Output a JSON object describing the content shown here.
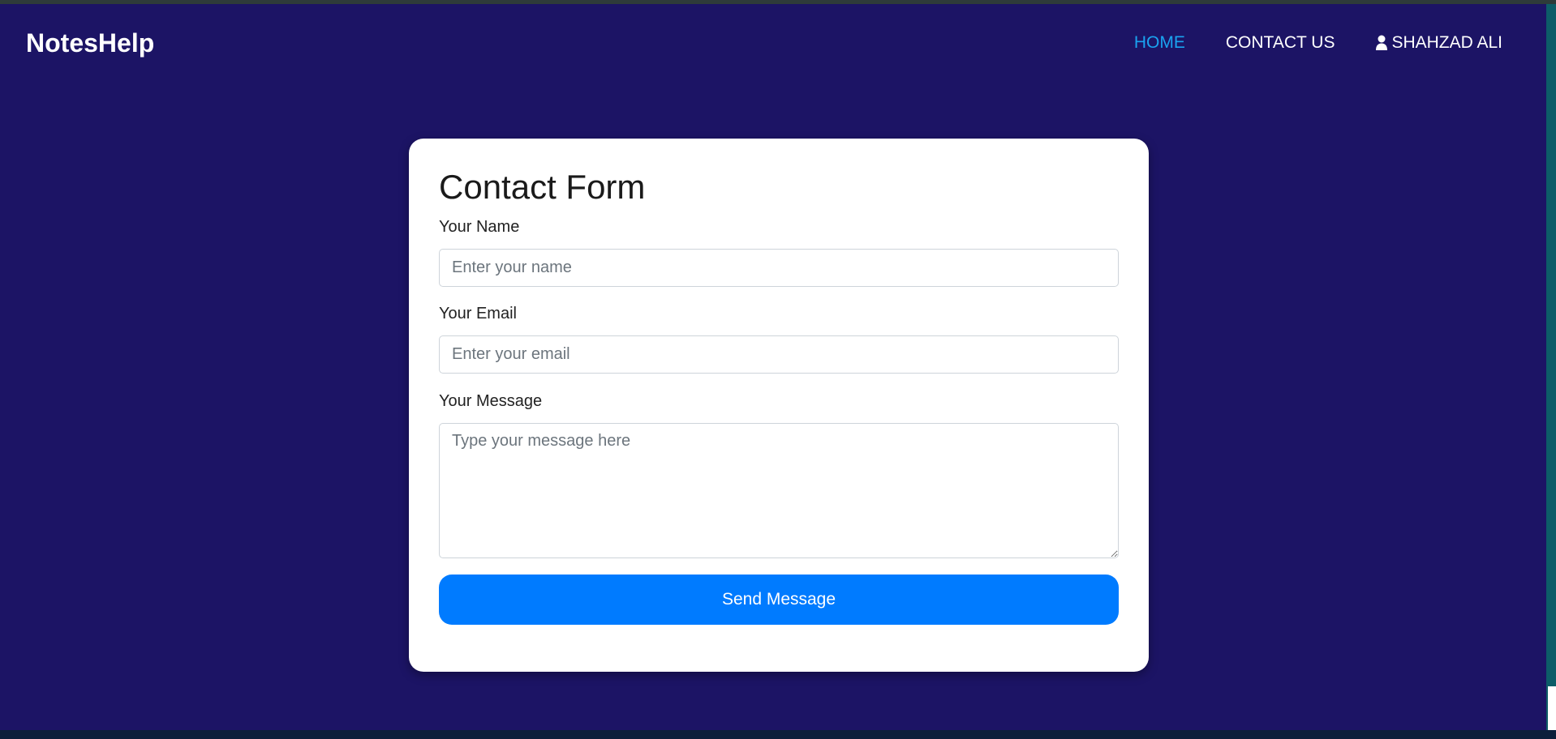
{
  "navbar": {
    "brand": "NotesHelp",
    "links": [
      {
        "label": "HOME",
        "active": true
      },
      {
        "label": "CONTACT US",
        "active": false
      },
      {
        "label": "SHAHZAD ALI",
        "icon": "user-icon",
        "active": false
      }
    ]
  },
  "form": {
    "title": "Contact Form",
    "name_label": "Your Name",
    "name_placeholder": "Enter your name",
    "email_label": "Your Email",
    "email_placeholder": "Enter your email",
    "message_label": "Your Message",
    "message_placeholder": "Type your message here",
    "submit_label": "Send Message"
  },
  "colors": {
    "background": "#1c1465",
    "active_link": "#1aa3f0",
    "button": "#007bff",
    "card": "#ffffff"
  }
}
